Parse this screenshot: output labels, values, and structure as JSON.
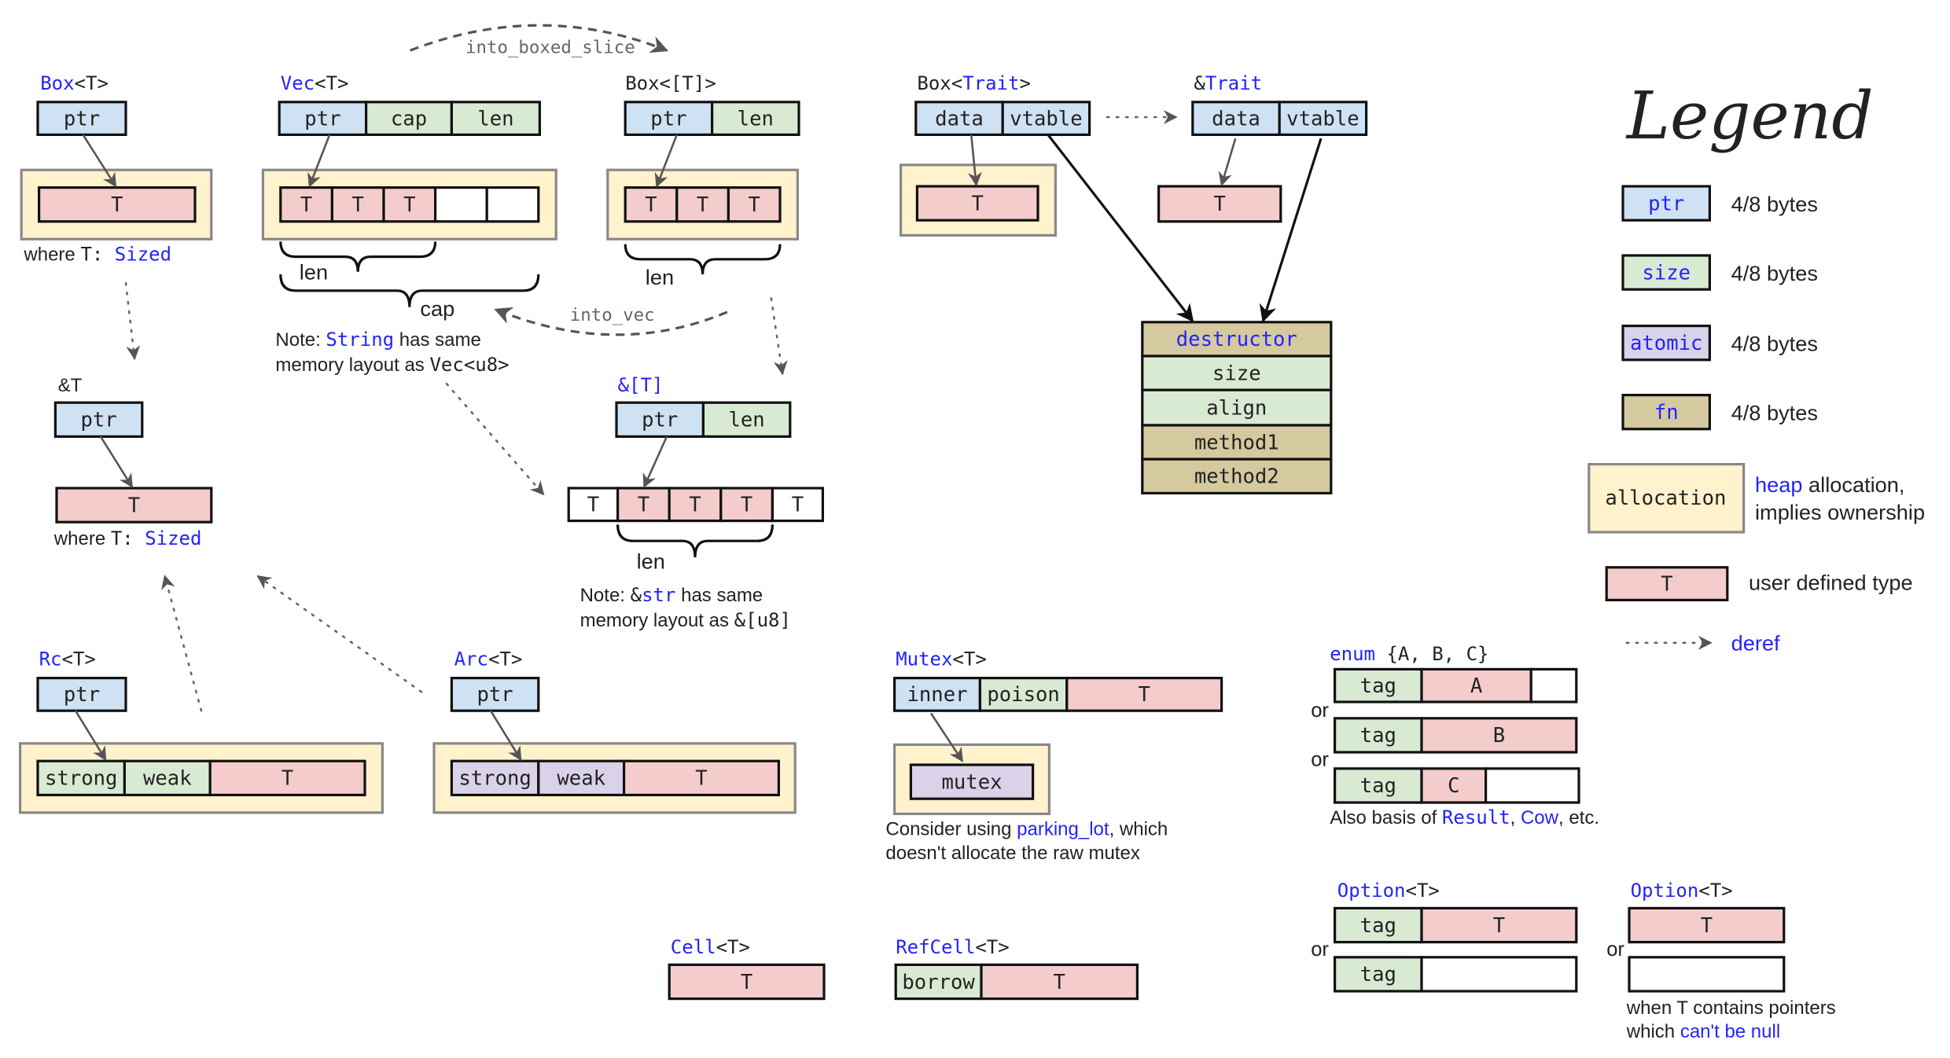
{
  "colors": {
    "ptr": "#cfe2f3",
    "size": "#d9ead3",
    "atomic": "#d9d2e9",
    "fn": "#d5c99f",
    "allocation": "#fff2cc",
    "user_type": "#f4cccc",
    "white": "#ffffff",
    "accent": "#2323ff",
    "text": "#222222",
    "arrow": "#555555"
  },
  "transitions": {
    "into_boxed_slice": "into_boxed_slice",
    "into_vec": "into_vec"
  },
  "box_t": {
    "title": [
      [
        "Box",
        "a",
        "m"
      ],
      [
        "<T>",
        "k",
        "m"
      ]
    ],
    "stack": [
      "ptr"
    ],
    "heap": [
      "T"
    ],
    "note": [
      [
        "where ",
        "k",
        "s"
      ],
      [
        "T: ",
        "k",
        "m"
      ],
      [
        "Sized",
        "a",
        "m"
      ]
    ]
  },
  "vec_t": {
    "title": [
      [
        "Vec",
        "a",
        "m"
      ],
      [
        "<T>",
        "k",
        "m"
      ]
    ],
    "stack": [
      "ptr",
      "cap",
      "len"
    ],
    "heap": [
      "T",
      "T",
      "T",
      "",
      ""
    ],
    "len_label": "len",
    "cap_label": "cap",
    "note1": [
      [
        "Note: ",
        "k",
        "s"
      ],
      [
        "String",
        "a",
        "m"
      ],
      [
        " has same",
        "k",
        "s"
      ]
    ],
    "note2": [
      [
        "memory layout as ",
        "k",
        "s"
      ],
      [
        "Vec<u8>",
        "k",
        "m"
      ]
    ]
  },
  "box_slice": {
    "title": [
      [
        "Box<[T]>",
        "k",
        "m"
      ]
    ],
    "stack": [
      "ptr",
      "len"
    ],
    "heap": [
      "T",
      "T",
      "T"
    ],
    "len_label": "len"
  },
  "ref_t": {
    "title": [
      [
        "&T",
        "k",
        "s"
      ]
    ],
    "stack": [
      "ptr"
    ],
    "target": [
      "T"
    ],
    "note": [
      [
        "where ",
        "k",
        "s"
      ],
      [
        "T: ",
        "k",
        "m"
      ],
      [
        "Sized",
        "a",
        "m"
      ]
    ]
  },
  "ref_slice": {
    "title": [
      [
        "&[T]",
        "a",
        "m"
      ]
    ],
    "stack": [
      "ptr",
      "len"
    ],
    "cells": [
      "T",
      "T",
      "T",
      "T",
      "T"
    ],
    "len_label": "len",
    "note1": [
      [
        "Note: ",
        "k",
        "s"
      ],
      [
        "&",
        "k",
        "m"
      ],
      [
        "str",
        "a",
        "m"
      ],
      [
        " has same",
        "k",
        "s"
      ]
    ],
    "note2": [
      [
        "memory layout as ",
        "k",
        "s"
      ],
      [
        "&[u8]",
        "k",
        "m"
      ]
    ]
  },
  "rc_t": {
    "title": [
      [
        "Rc",
        "a",
        "m"
      ],
      [
        "<T>",
        "k",
        "m"
      ]
    ],
    "stack": [
      "ptr"
    ],
    "heap": [
      "strong",
      "weak",
      "T"
    ]
  },
  "arc_t": {
    "title": [
      [
        "Arc",
        "a",
        "m"
      ],
      [
        "<T>",
        "k",
        "m"
      ]
    ],
    "stack": [
      "ptr"
    ],
    "heap": [
      "strong",
      "weak",
      "T"
    ]
  },
  "box_trait": {
    "title": [
      [
        "Box<",
        "k",
        "m"
      ],
      [
        "Trait",
        "a",
        "m"
      ],
      [
        ">",
        "k",
        "m"
      ]
    ],
    "stack": [
      "data",
      "vtable"
    ],
    "heap": [
      "T"
    ]
  },
  "ref_trait": {
    "title": [
      [
        "&",
        "k",
        "m"
      ],
      [
        "Trait",
        "a",
        "m"
      ]
    ],
    "stack": [
      "data",
      "vtable"
    ],
    "target": [
      "T"
    ]
  },
  "vtable": [
    "destructor",
    "size",
    "align",
    "method1",
    "method2"
  ],
  "mutex_t": {
    "title": [
      [
        "Mutex",
        "a",
        "m"
      ],
      [
        "<T>",
        "k",
        "m"
      ]
    ],
    "stack": [
      "inner",
      "poison",
      "T"
    ],
    "heap": [
      "mutex"
    ],
    "note1": [
      [
        "Consider using ",
        "k",
        "s"
      ],
      [
        "parking_lot",
        "a",
        "s"
      ],
      [
        ", which",
        "k",
        "s"
      ]
    ],
    "note2": [
      [
        "doesn't allocate the raw mutex",
        "k",
        "s"
      ]
    ]
  },
  "enum_abc": {
    "title": [
      [
        "enum",
        "a",
        "m"
      ],
      [
        " {A, B, C}",
        "k",
        "m"
      ]
    ],
    "rows": [
      [
        "tag",
        "A",
        ""
      ],
      [
        "tag",
        "B"
      ],
      [
        "tag",
        "C",
        ""
      ]
    ],
    "or": "or",
    "note": [
      [
        "Also basis of ",
        "k",
        "s"
      ],
      [
        "Result",
        "a",
        "m"
      ],
      [
        ", ",
        "k",
        "s"
      ],
      [
        "Cow",
        "a",
        "s"
      ],
      [
        ", etc.",
        "k",
        "s"
      ]
    ]
  },
  "option_tag": {
    "title": [
      [
        "Option",
        "a",
        "m"
      ],
      [
        "<T>",
        "k",
        "m"
      ]
    ],
    "rows": [
      [
        "tag",
        "T"
      ],
      [
        "tag",
        ""
      ]
    ],
    "or": "or"
  },
  "option_niche": {
    "title": [
      [
        "Option",
        "a",
        "m"
      ],
      [
        "<T>",
        "k",
        "m"
      ]
    ],
    "rows": [
      [
        "T"
      ],
      [
        ""
      ]
    ],
    "or": "or",
    "note1": [
      [
        "when T contains pointers",
        "k",
        "s"
      ]
    ],
    "note2": [
      [
        "which ",
        "k",
        "s"
      ],
      [
        "can't be null",
        "a",
        "s"
      ]
    ]
  },
  "cell_t": {
    "title": [
      [
        "Cell",
        "a",
        "m"
      ],
      [
        "<T>",
        "k",
        "m"
      ]
    ],
    "cells": [
      "T"
    ]
  },
  "refcell_t": {
    "title": [
      [
        "RefCell",
        "a",
        "m"
      ],
      [
        "<T>",
        "k",
        "m"
      ]
    ],
    "cells": [
      "borrow",
      "T"
    ]
  },
  "legend": {
    "title": "Legend",
    "items": [
      {
        "swatch": "ptr",
        "desc": "4/8 bytes"
      },
      {
        "swatch": "size",
        "desc": "4/8 bytes"
      },
      {
        "swatch": "atomic",
        "desc": "4/8 bytes"
      },
      {
        "swatch": "fn",
        "desc": "4/8 bytes"
      }
    ],
    "allocation": {
      "swatch": "allocation",
      "desc1": [
        [
          "heap",
          "a",
          "s"
        ],
        [
          " allocation,",
          "k",
          "s"
        ]
      ],
      "desc2": [
        [
          "implies ownership",
          "k",
          "s"
        ]
      ]
    },
    "user_type": {
      "swatch": "T",
      "desc": "user defined type"
    },
    "deref": "deref"
  }
}
